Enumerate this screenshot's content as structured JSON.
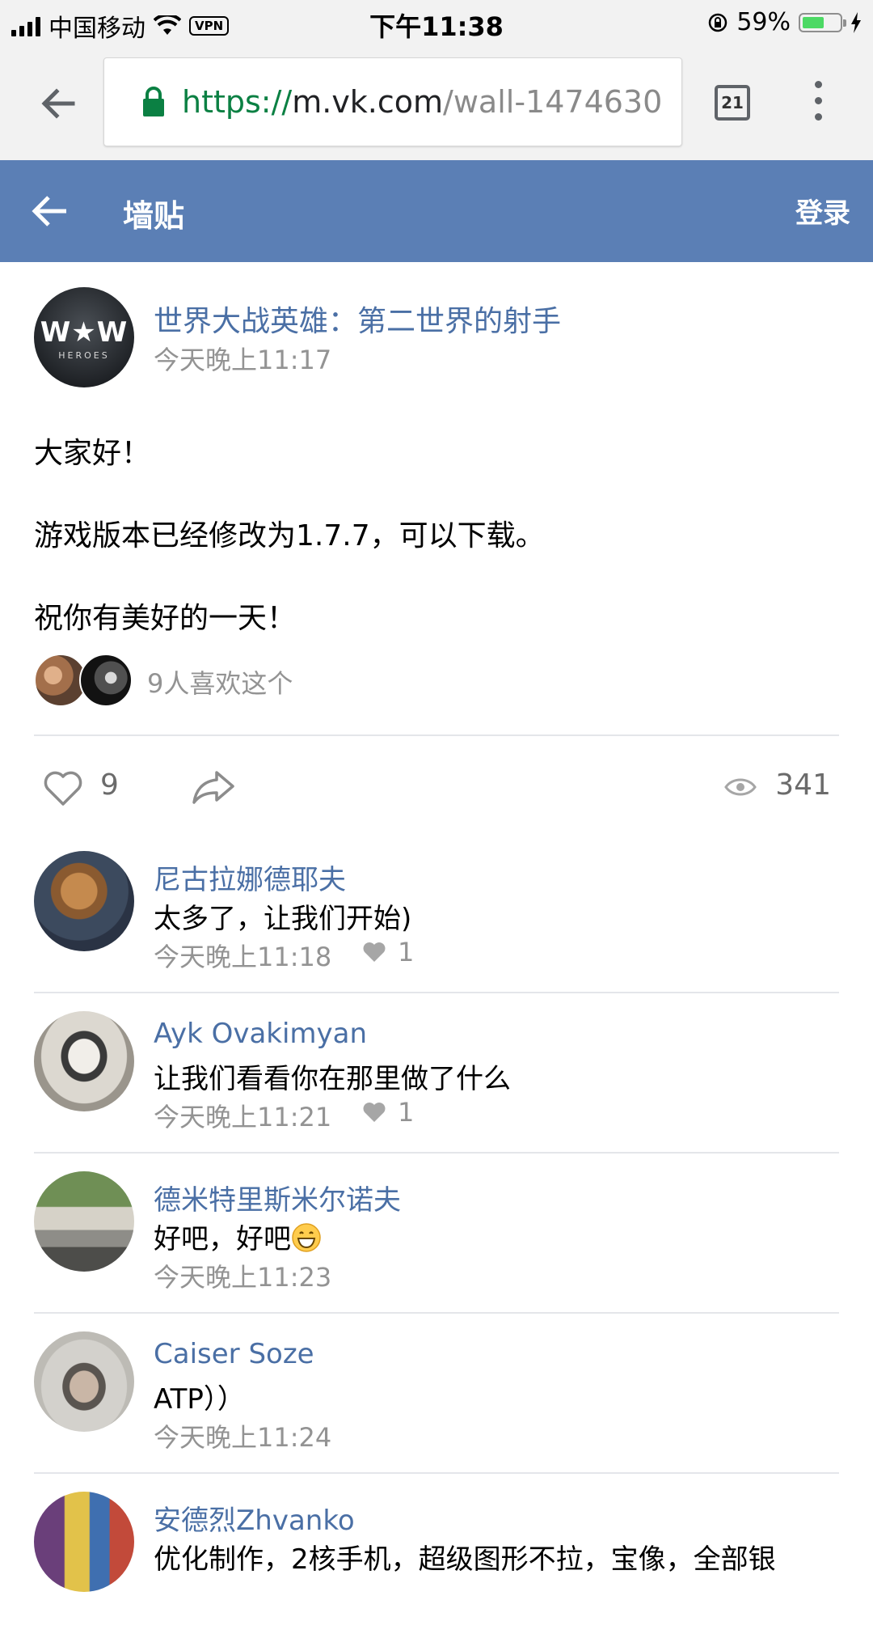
{
  "status_bar": {
    "carrier": "中国移动",
    "vpn": "VPN",
    "time": "下午11:38",
    "battery_percent": "59%",
    "battery_level": 0.59
  },
  "browser": {
    "url_scheme": "https://",
    "url_host": "m.vk.com",
    "url_path": "/wall-1474630",
    "tab_count": "21"
  },
  "app_bar": {
    "title": "墙贴",
    "login_label": "登录",
    "color": "#5b7fb5"
  },
  "post": {
    "page_logo": "W★W",
    "page_logo_sub": "HEROES",
    "author": "世界大战英雄：第二世界的射手",
    "time": "今天晚上11:17",
    "text": [
      "大家好！",
      "游戏版本已经修改为1.7.7，可以下载。",
      "祝你有美好的一天！"
    ],
    "likes_summary": "9人喜欢这个",
    "like_count": "9",
    "view_count": "341"
  },
  "comments": [
    {
      "name": "尼古拉娜德耶夫",
      "text": "太多了，让我们开始)",
      "time": "今天晚上11:18",
      "likes": "1",
      "avatar": "teddy-bear"
    },
    {
      "name": "Ayk Ovakimyan",
      "text": "让我们看看你在那里做了什么",
      "time": "今天晚上11:21",
      "likes": "1",
      "avatar": "man-portrait"
    },
    {
      "name": "德米特里斯米尔诺夫",
      "text": "好吧，好吧",
      "emoji": "grinning-face",
      "time": "今天晚上11:23",
      "avatar": "car"
    },
    {
      "name": "Caiser Soze",
      "text": "ATP））",
      "time": "今天晚上11:24",
      "avatar": "man-photo"
    },
    {
      "name": "安德烈Zhvanko",
      "text": "优化制作，2核手机，超级图形不拉，宝像，全部银",
      "avatar": "child-photo"
    }
  ]
}
